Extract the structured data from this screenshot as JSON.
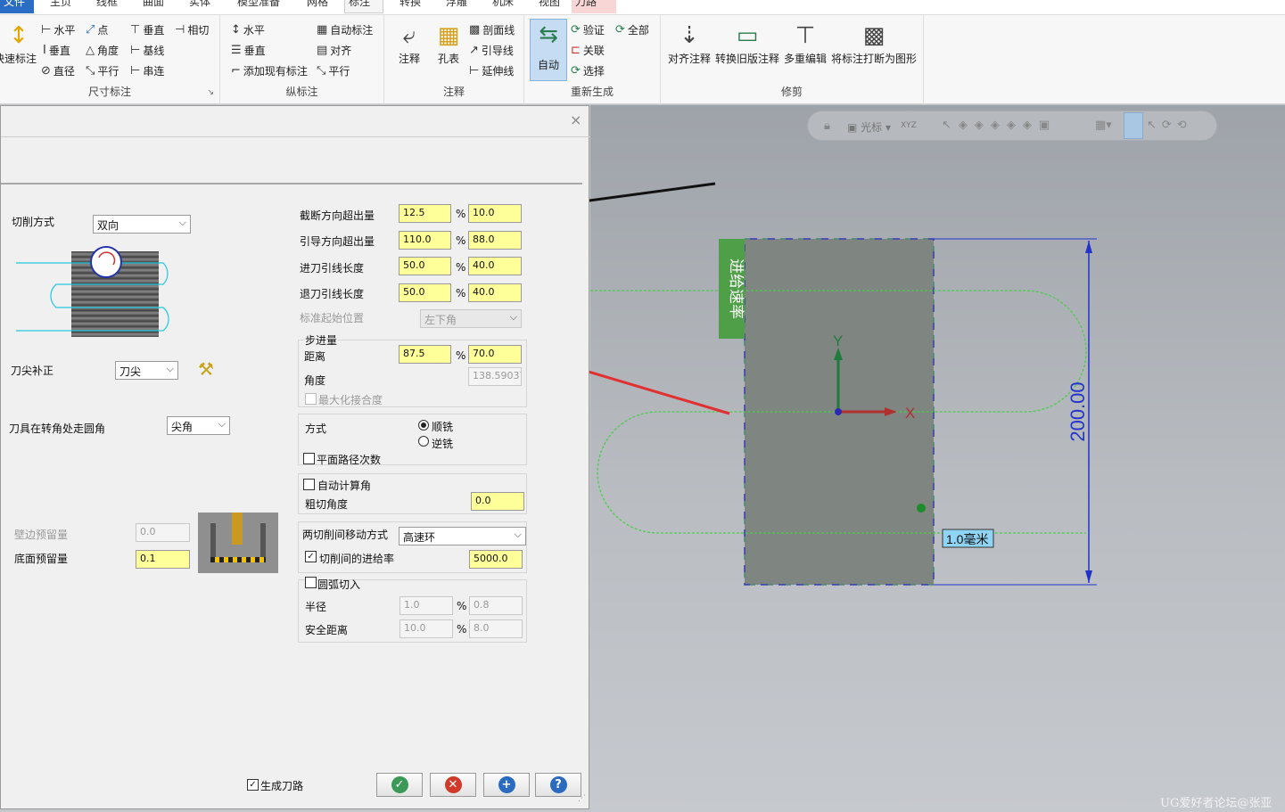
{
  "menu": {
    "tabs": [
      "文件",
      "主页",
      "线框",
      "曲面",
      "实体",
      "模型准备",
      "网格",
      "标注",
      "转换",
      "浮雕",
      "机床",
      "视图",
      "刀路"
    ]
  },
  "ribbon": {
    "groups": [
      {
        "label": "尺寸标注",
        "big": "快速标注",
        "items": [
          "水平",
          "点",
          "垂直",
          "相切",
          "垂直",
          "角度",
          "基线",
          "直径",
          "平行",
          "串连"
        ]
      },
      {
        "label": "纵标注",
        "items": [
          "水平",
          "自动标注",
          "垂直",
          "对齐",
          "添加现有标注",
          "平行"
        ]
      },
      {
        "label": "注释",
        "items": [
          "注释",
          "孔表",
          "剖面线",
          "引导线",
          "延伸线"
        ]
      },
      {
        "label": "重新生成",
        "items": [
          "自动",
          "验证",
          "全部",
          "关联",
          "选择"
        ]
      },
      {
        "label": "修剪",
        "items": [
          "对齐注释",
          "转换旧版注释",
          "多重编辑",
          "将标注打断为图形"
        ]
      }
    ]
  },
  "viewport_toolbar": {
    "cursor_label": "光标",
    "xyz": "XYZ"
  },
  "dialog": {
    "close": "×",
    "cut_method": {
      "label": "切削方式",
      "value": "双向"
    },
    "tip_comp": {
      "label": "刀尖补正",
      "value": "刀尖"
    },
    "corner": {
      "label": "刀具在转角处走圆角",
      "value": "尖角"
    },
    "wall_stock": {
      "label": "壁边预留量",
      "value": "0.0"
    },
    "floor_stock": {
      "label": "底面预留量",
      "value": "0.1"
    },
    "overlaps": [
      {
        "label": "截断方向超出量",
        "v1": "12.5",
        "pct": "%",
        "v2": "10.0"
      },
      {
        "label": "引导方向超出量",
        "v1": "110.0",
        "pct": "%",
        "v2": "88.0"
      },
      {
        "label": "进刀引线长度",
        "v1": "50.0",
        "pct": "%",
        "v2": "40.0"
      },
      {
        "label": "退刀引线长度",
        "v1": "50.0",
        "pct": "%",
        "v2": "40.0"
      }
    ],
    "start_pos": {
      "label": "标准起始位置",
      "value": "左下角"
    },
    "stepover": {
      "title": "步进量",
      "distance_label": "距离",
      "d1": "87.5",
      "pct": "%",
      "d2": "70.0",
      "angle_label": "角度",
      "angle": "138.59037",
      "maximize": "最大化接合度"
    },
    "direction": {
      "label": "方式",
      "climb": "顺铣",
      "conventional": "逆铣",
      "flat_passes": "平面路径次数"
    },
    "auto_angle": {
      "label": "自动计算角",
      "rough_label": "粗切角度",
      "rough_value": "0.0"
    },
    "between_cuts": {
      "label": "两切削间移动方式",
      "value": "高速环",
      "feed_label": "切削间的进给率",
      "feed_value": "5000.0"
    },
    "arc_entry": {
      "label": "圆弧切入",
      "radius_label": "半径",
      "r1": "1.0",
      "pct": "%",
      "r2": "0.8",
      "safe_label": "安全距离",
      "s1": "10.0",
      "s2": "8.0"
    },
    "generate": "生成刀路"
  },
  "graphics": {
    "feed_label": "进给速率",
    "dim_value": "200.00",
    "tag": "1.0毫米",
    "axis_y": "Y",
    "axis_x": "X"
  },
  "watermark": "UG爱好者论坛@张亚",
  "colors": {
    "input_yellow": "#ffff99",
    "toolpath_green": "#44cc44",
    "dim_blue": "#2233cc",
    "arrow_red": "#e03030",
    "feed_tag": "#55aa44"
  }
}
